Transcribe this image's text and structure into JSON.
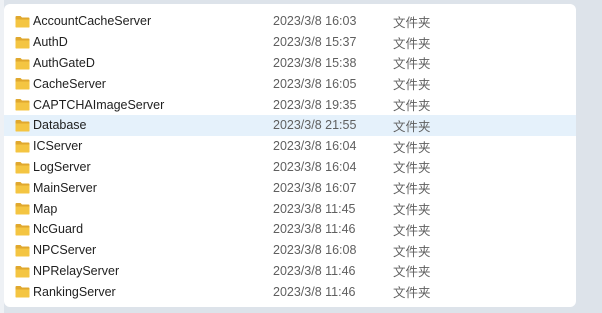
{
  "file_list": {
    "selected_index": 5,
    "rows": [
      {
        "name": "AccountCacheServer",
        "modified": "2023/3/8 16:03",
        "type": "文件夹",
        "icon": "folder-icon"
      },
      {
        "name": "AuthD",
        "modified": "2023/3/8 15:37",
        "type": "文件夹",
        "icon": "folder-icon"
      },
      {
        "name": "AuthGateD",
        "modified": "2023/3/8 15:38",
        "type": "文件夹",
        "icon": "folder-icon"
      },
      {
        "name": "CacheServer",
        "modified": "2023/3/8 16:05",
        "type": "文件夹",
        "icon": "folder-icon"
      },
      {
        "name": "CAPTCHAImageServer",
        "modified": "2023/3/8 19:35",
        "type": "文件夹",
        "icon": "folder-icon"
      },
      {
        "name": "Database",
        "modified": "2023/3/8 21:55",
        "type": "文件夹",
        "icon": "folder-icon"
      },
      {
        "name": "ICServer",
        "modified": "2023/3/8 16:04",
        "type": "文件夹",
        "icon": "folder-icon"
      },
      {
        "name": "LogServer",
        "modified": "2023/3/8 16:04",
        "type": "文件夹",
        "icon": "folder-icon"
      },
      {
        "name": "MainServer",
        "modified": "2023/3/8 16:07",
        "type": "文件夹",
        "icon": "folder-icon"
      },
      {
        "name": "Map",
        "modified": "2023/3/8 11:45",
        "type": "文件夹",
        "icon": "folder-icon"
      },
      {
        "name": "NcGuard",
        "modified": "2023/3/8 11:46",
        "type": "文件夹",
        "icon": "folder-icon"
      },
      {
        "name": "NPCServer",
        "modified": "2023/3/8 16:08",
        "type": "文件夹",
        "icon": "folder-icon"
      },
      {
        "name": "NPRelayServer",
        "modified": "2023/3/8 11:46",
        "type": "文件夹",
        "icon": "folder-icon"
      },
      {
        "name": "RankingServer",
        "modified": "2023/3/8 11:46",
        "type": "文件夹",
        "icon": "folder-icon"
      }
    ]
  },
  "colors": {
    "selected_row": "#e5f1fb",
    "folder_body": "#f4c542",
    "folder_tab": "#e0a82e"
  }
}
